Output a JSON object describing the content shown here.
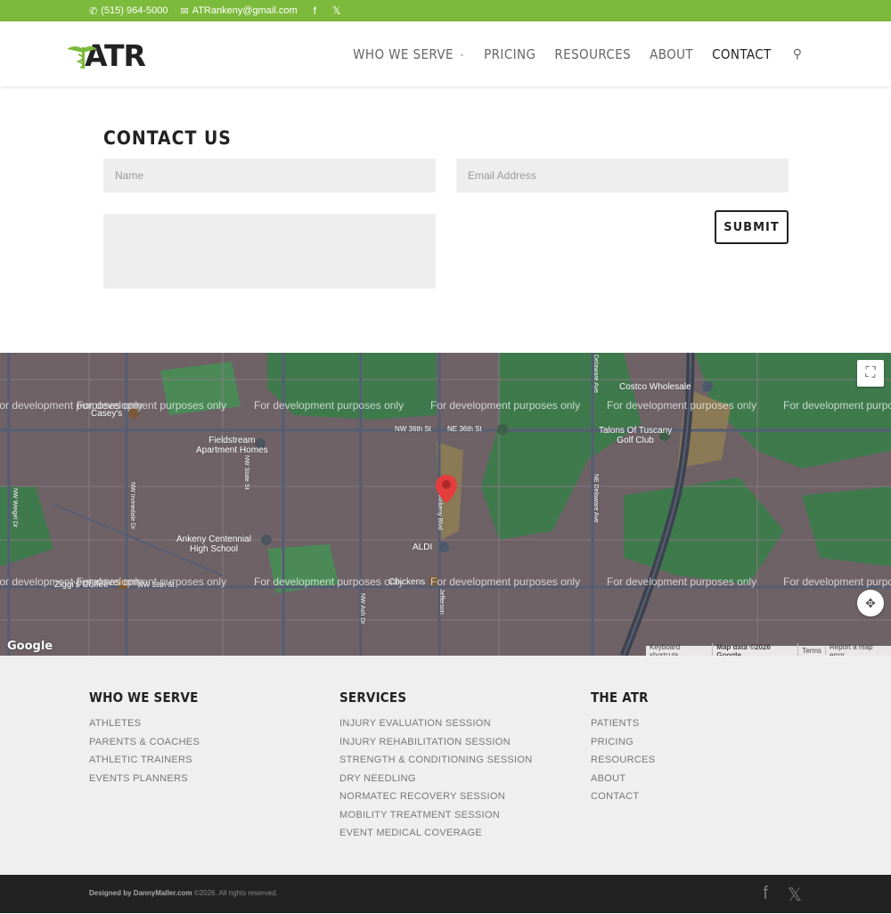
{
  "topbar": {
    "phone": "(515) 964-5000",
    "email": "ATRankeny@gmail.com"
  },
  "logo": {
    "text": "ATR"
  },
  "nav": {
    "items": [
      "WHO WE SERVE",
      "PRICING",
      "RESOURCES",
      "ABOUT",
      "CONTACT"
    ],
    "active": "CONTACT"
  },
  "contact": {
    "title": "CONTACT US",
    "name_placeholder": "Name",
    "email_placeholder": "Email Address",
    "submit_label": "SUBMIT"
  },
  "map": {
    "watermark": "For development purposes only",
    "labels": {
      "costco": "Costco Wholesale",
      "caseys": "Casey's",
      "fieldstream": "Fieldstream\nApartment Homes",
      "nw36": "NW 36th St",
      "ne36": "NE 36th St",
      "talons": "Talons Of Tuscany\nGolf Club",
      "ankeny_hs": "Ankeny Centennial\nHigh School",
      "aldi": "ALDI",
      "ziggis": "Ziggi's Coffee",
      "nw18": "NW 18th St",
      "chickens": "Chickens",
      "nw_state": "NW State St",
      "nw_irvine": "NW Irvinedale Dr",
      "nw_weigel": "NW Weigel Dr",
      "ankeny_blvd": "Ankeny Blvd",
      "nw_ash": "NW Ash Dr",
      "jefferson": "Jefferson",
      "delaware": "Delaware Ave",
      "ne_delaware": "NE Delaware Ave"
    },
    "google": "Google",
    "attribution": {
      "shortcuts": "Keyboard shortcuts",
      "mapdata": "Map data ©2026 Google",
      "terms": "Terms",
      "report": "Report a map error"
    }
  },
  "footer": {
    "col1": {
      "title": "WHO WE SERVE",
      "links": [
        "ATHLETES",
        "PARENTS & COACHES",
        "ATHLETIC TRAINERS",
        "EVENTS PLANNERS"
      ]
    },
    "col2": {
      "title": "SERVICES",
      "links": [
        "INJURY EVALUATION SESSION",
        "INJURY REHABILITATION SESSION",
        "STRENGTH & CONDITIONING SESSION",
        "DRY NEEDLING",
        "NORMATEC RECOVERY SESSION",
        "MOBILITY TREATMENT SESSION",
        "EVENT MEDICAL COVERAGE"
      ]
    },
    "col3": {
      "title": "THE ATR",
      "links": [
        "PATIENTS",
        "PRICING",
        "RESOURCES",
        "ABOUT",
        "CONTACT"
      ]
    },
    "credit_bold": "Designed by DannyMaller.com",
    "credit_rest": " ©2026. All rights reserved."
  },
  "colors": {
    "accent": "#7cba3b",
    "footer_bg": "#efefef",
    "bottombar_bg": "#222222"
  }
}
